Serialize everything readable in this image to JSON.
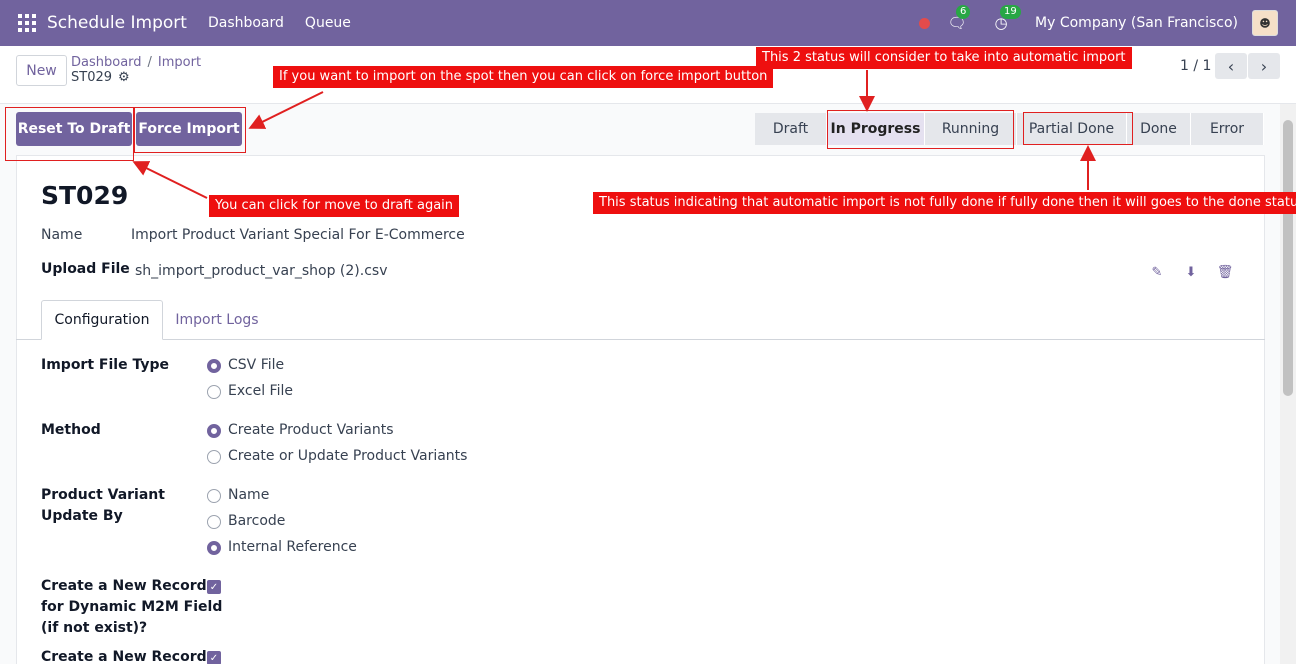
{
  "navbar": {
    "app_title": "Schedule Import",
    "menu": [
      "Dashboard",
      "Queue"
    ],
    "messages_badge": "6",
    "activity_badge": "19",
    "company": "My Company (San Francisco)"
  },
  "control_panel": {
    "new_label": "New",
    "breadcrumb": [
      "Dashboard",
      "Import"
    ],
    "record": "ST029",
    "pager": "1 / 1"
  },
  "actions": {
    "reset_to_draft": "Reset To Draft",
    "force_import": "Force Import"
  },
  "status": {
    "stages": [
      "Draft",
      "In Progress",
      "Running",
      "Partial Done",
      "Done",
      "Error"
    ],
    "active": "In Progress"
  },
  "form": {
    "title": "ST029",
    "name_label": "Name",
    "name_value": "Import Product Variant Special For E-Commerce",
    "upload_label": "Upload File",
    "upload_value": "sh_import_product_var_shop (2).csv",
    "tabs": [
      "Configuration",
      "Import Logs"
    ],
    "file_type_label": "Import File Type",
    "file_type_options": [
      "CSV File",
      "Excel File"
    ],
    "method_label": "Method",
    "method_options": [
      "Create Product Variants",
      "Create or Update Product Variants"
    ],
    "update_by_label_1": "Product Variant",
    "update_by_label_2": "Update By",
    "update_by_options": [
      "Name",
      "Barcode",
      "Internal Reference"
    ],
    "m2m_label_1": "Create a New Record",
    "m2m_label_2": "for Dynamic M2M Field",
    "m2m_label_3": "(if not exist)?",
    "next_label": "Create a New Record"
  },
  "annotations": {
    "force": "If you want to import on the spot then you can click on force import button",
    "status2": "This 2 status will consider to take into automatic import",
    "draft": "You can click for move to draft again",
    "partial": "This status indicating that automatic import is not fully done if fully done then it will goes to the done status"
  },
  "colors": {
    "brand": "#71639e",
    "annotation": "#ee0f0f"
  }
}
